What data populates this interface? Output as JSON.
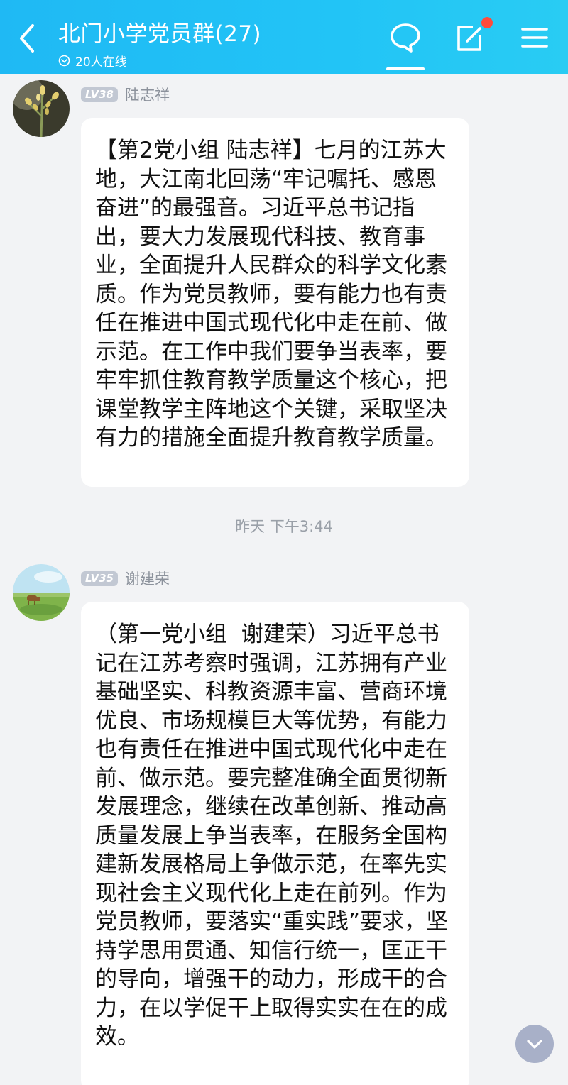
{
  "header": {
    "title": "北门小学党员群(27)",
    "online_status": "20人在线",
    "accent_color": "#22c4f6",
    "icons": [
      "back-icon",
      "chat-bubble-icon",
      "edit-icon",
      "menu-icon"
    ]
  },
  "messages": [
    {
      "level": "LV38",
      "sender": "陆志祥",
      "avatar": "plant-photo",
      "text": "【第2党小组 陆志祥】七月的江苏大地，大江南北回荡“牢记嘱托、感恩奋进”的最强音。习近平总书记指出，要大力发展现代科技、教育事业，全面提升人民群众的科学文化素质。作为党员教师，要有能力也有责任在推进中国式现代化中走在前、做示范。在工作中我们要争当表率，要牢牢抓住教育教学质量这个核心，把课堂教学主阵地这个关键，采取坚决有力的措施全面提升教育教学质量。"
    },
    {
      "level": "LV35",
      "sender": "谢建荣",
      "avatar": "grassland-cow-photo",
      "text": "（第一党小组  谢建荣）习近平总书记在江苏考察时强调，江苏拥有产业基础坚实、科教资源丰富、营商环境优良、市场规模巨大等优势，有能力也有责任在推进中国式现代化中走在前、做示范。要完整准确全面贯彻新发展理念，继续在改革创新、推动高质量发展上争当表率，在服务全国构建新发展格局上争做示范，在率先实现社会主义现代化上走在前列。作为党员教师，要落实“重实践”要求，坚持学思用贯通、知信行统一，匡正干的导向，增强干的动力，形成干的合力，在以学促干上取得实实在在的成效。"
    }
  ],
  "timestamp": "昨天 下午3:44"
}
